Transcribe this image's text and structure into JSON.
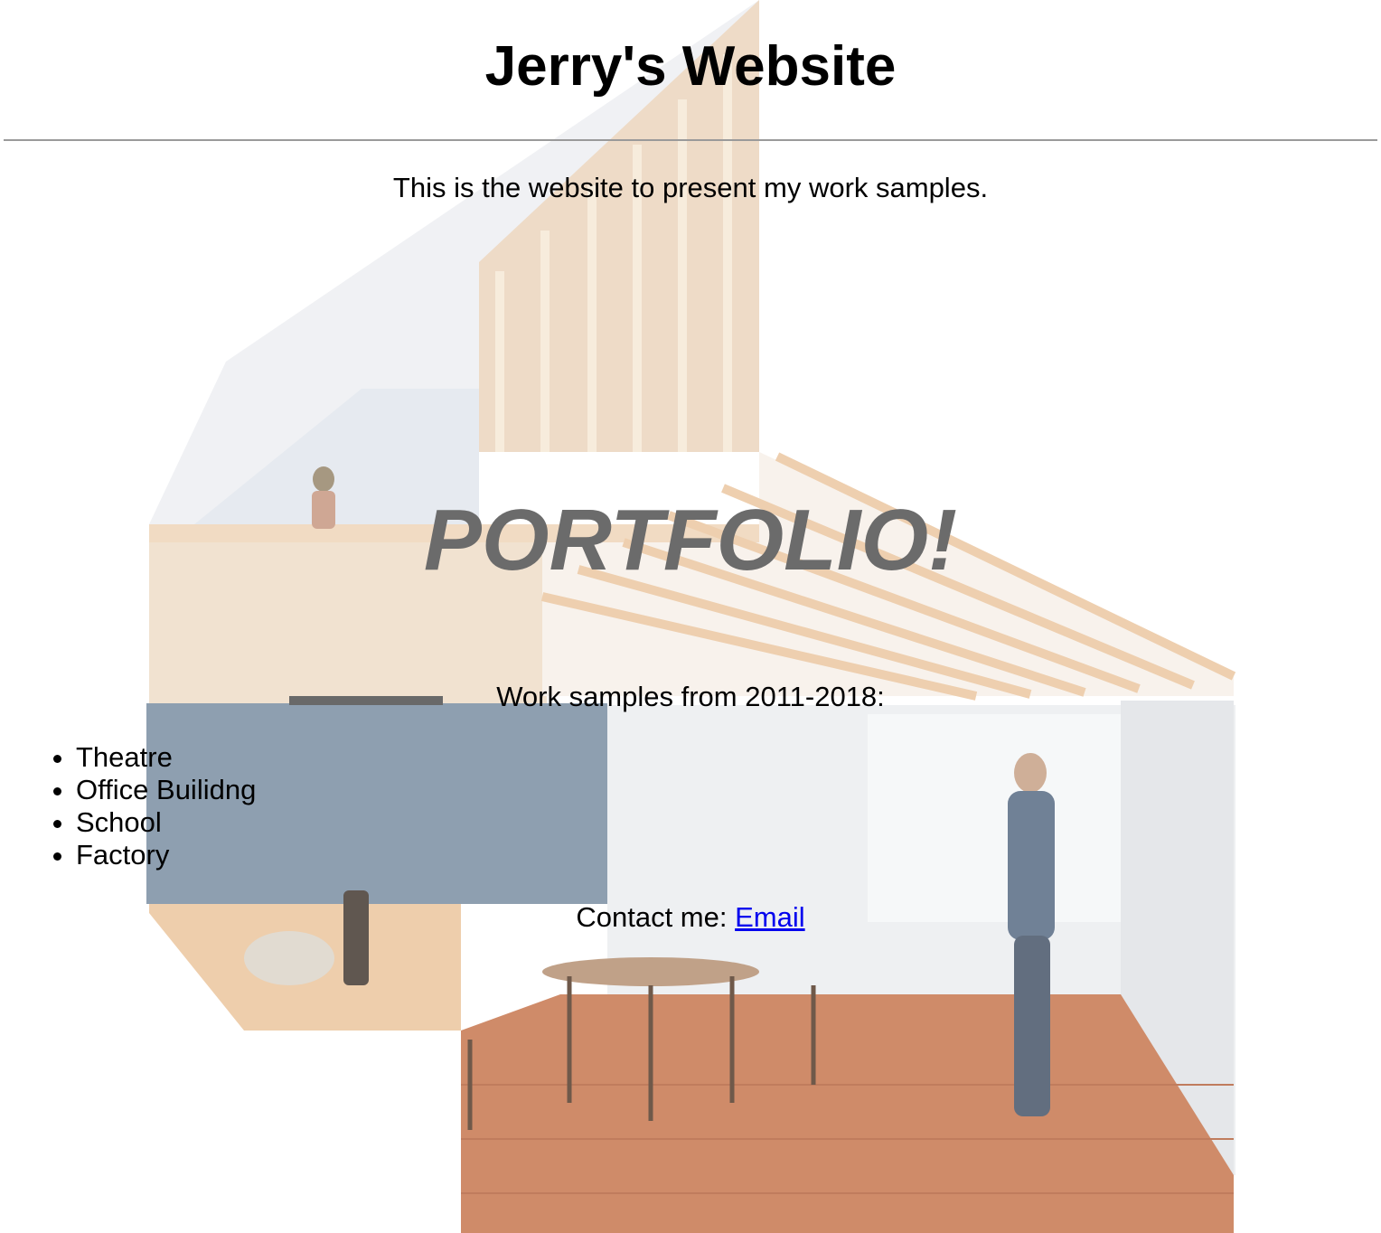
{
  "header": {
    "title": "Jerry's Website"
  },
  "intro": {
    "text": "This is the website to present my work samples."
  },
  "hero": {
    "text": "PORTFOLIO!"
  },
  "samples": {
    "heading": "Work samples from 2011-2018:",
    "items": [
      "Theatre",
      "Office Builidng",
      "School",
      "Factory"
    ]
  },
  "contact": {
    "label": "Contact me:",
    "link_text": "Email"
  },
  "background": {
    "description_icon": "architectural-section-illustration"
  },
  "colors": {
    "link": "#0000ee",
    "hero": "#6b6b6b",
    "rule": "#9a9a9a"
  }
}
